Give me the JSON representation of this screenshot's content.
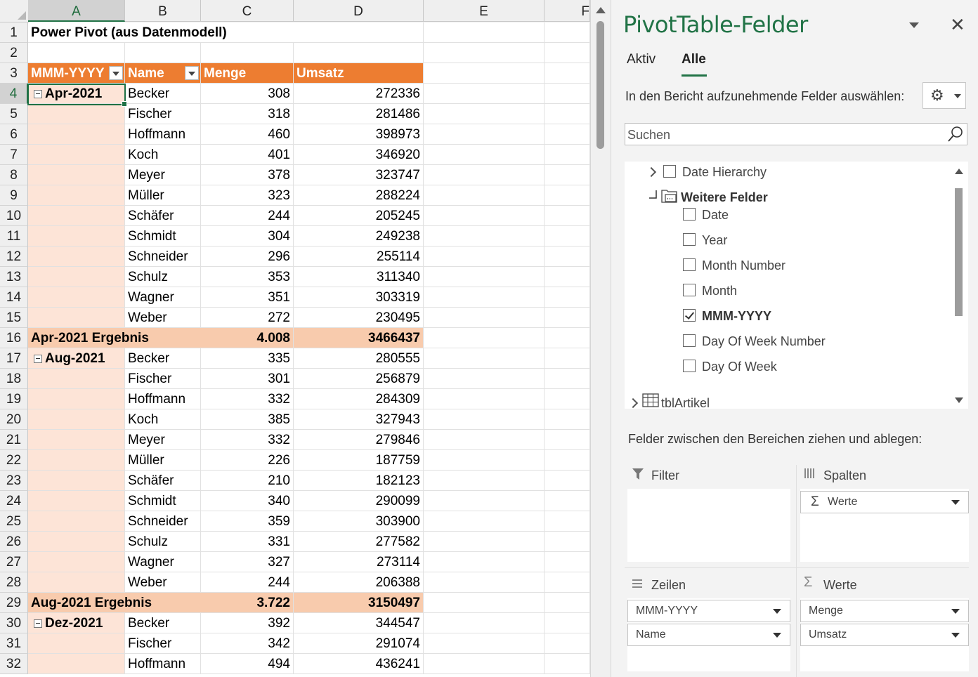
{
  "sheet": {
    "columns": [
      "A",
      "B",
      "C",
      "D",
      "E",
      "F"
    ],
    "title": "Power Pivot (aus Datenmodell)",
    "header": {
      "col_a": "MMM-YYYY",
      "col_b": "Name",
      "col_c": "Menge",
      "col_d": "Umsatz"
    },
    "rows": [
      {
        "n": "4",
        "group": "Apr-2021",
        "name": "Becker",
        "menge": "308",
        "umsatz": "272336"
      },
      {
        "n": "5",
        "name": "Fischer",
        "menge": "318",
        "umsatz": "281486"
      },
      {
        "n": "6",
        "name": "Hoffmann",
        "menge": "460",
        "umsatz": "398973"
      },
      {
        "n": "7",
        "name": "Koch",
        "menge": "401",
        "umsatz": "346920"
      },
      {
        "n": "8",
        "name": "Meyer",
        "menge": "378",
        "umsatz": "323747"
      },
      {
        "n": "9",
        "name": "Müller",
        "menge": "323",
        "umsatz": "288224"
      },
      {
        "n": "10",
        "name": "Schäfer",
        "menge": "244",
        "umsatz": "205245"
      },
      {
        "n": "11",
        "name": "Schmidt",
        "menge": "304",
        "umsatz": "249238"
      },
      {
        "n": "12",
        "name": "Schneider",
        "menge": "296",
        "umsatz": "255114"
      },
      {
        "n": "13",
        "name": "Schulz",
        "menge": "353",
        "umsatz": "311340"
      },
      {
        "n": "14",
        "name": "Wagner",
        "menge": "351",
        "umsatz": "303319"
      },
      {
        "n": "15",
        "name": "Weber",
        "menge": "272",
        "umsatz": "230495"
      },
      {
        "n": "16",
        "subtotal": "Apr-2021 Ergebnis",
        "menge": "4.008",
        "umsatz": "3466437"
      },
      {
        "n": "17",
        "group": "Aug-2021",
        "name": "Becker",
        "menge": "335",
        "umsatz": "280555"
      },
      {
        "n": "18",
        "name": "Fischer",
        "menge": "301",
        "umsatz": "256879"
      },
      {
        "n": "19",
        "name": "Hoffmann",
        "menge": "332",
        "umsatz": "284309"
      },
      {
        "n": "20",
        "name": "Koch",
        "menge": "385",
        "umsatz": "327943"
      },
      {
        "n": "21",
        "name": "Meyer",
        "menge": "332",
        "umsatz": "279846"
      },
      {
        "n": "22",
        "name": "Müller",
        "menge": "226",
        "umsatz": "187759"
      },
      {
        "n": "23",
        "name": "Schäfer",
        "menge": "210",
        "umsatz": "182123"
      },
      {
        "n": "24",
        "name": "Schmidt",
        "menge": "340",
        "umsatz": "290099"
      },
      {
        "n": "25",
        "name": "Schneider",
        "menge": "359",
        "umsatz": "303900"
      },
      {
        "n": "26",
        "name": "Schulz",
        "menge": "331",
        "umsatz": "277582"
      },
      {
        "n": "27",
        "name": "Wagner",
        "menge": "327",
        "umsatz": "273114"
      },
      {
        "n": "28",
        "name": "Weber",
        "menge": "244",
        "umsatz": "206388"
      },
      {
        "n": "29",
        "subtotal": "Aug-2021 Ergebnis",
        "menge": "3.722",
        "umsatz": "3150497"
      },
      {
        "n": "30",
        "group": "Dez-2021",
        "name": "Becker",
        "menge": "392",
        "umsatz": "344547"
      },
      {
        "n": "31",
        "name": "Fischer",
        "menge": "342",
        "umsatz": "291074"
      },
      {
        "n": "32",
        "name": "Hoffmann",
        "menge": "494",
        "umsatz": "436241"
      }
    ]
  },
  "pane": {
    "title": "PivotTable-Felder",
    "tabs": [
      "Aktiv",
      "Alle"
    ],
    "active_tab": "Alle",
    "instruction": "In den Bericht aufzunehmende Felder auswählen:",
    "search_placeholder": "Suchen",
    "fields": {
      "date_hierarchy": "Date Hierarchy",
      "more_fields": "Weitere Felder",
      "items": [
        {
          "label": "Date",
          "checked": false
        },
        {
          "label": "Year",
          "checked": false
        },
        {
          "label": "Month Number",
          "checked": false
        },
        {
          "label": "Month",
          "checked": false
        },
        {
          "label": "MMM-YYYY",
          "checked": true
        },
        {
          "label": "Day Of Week Number",
          "checked": false
        },
        {
          "label": "Day Of Week",
          "checked": false
        }
      ],
      "table": "tblArtikel"
    },
    "drag_instruction": "Felder zwischen den Bereichen ziehen und ablegen:",
    "areas": {
      "filter": "Filter",
      "columns": "Spalten",
      "columns_items": [
        "Werte"
      ],
      "rows": "Zeilen",
      "rows_items": [
        "MMM-YYYY",
        "Name"
      ],
      "values": "Werte",
      "values_items": [
        "Menge",
        "Umsatz"
      ]
    }
  },
  "colors": {
    "accent": "#217346",
    "header_orange": "#ed7d31",
    "subtotal": "#f8cbad",
    "group_fill": "#fde4d7"
  }
}
